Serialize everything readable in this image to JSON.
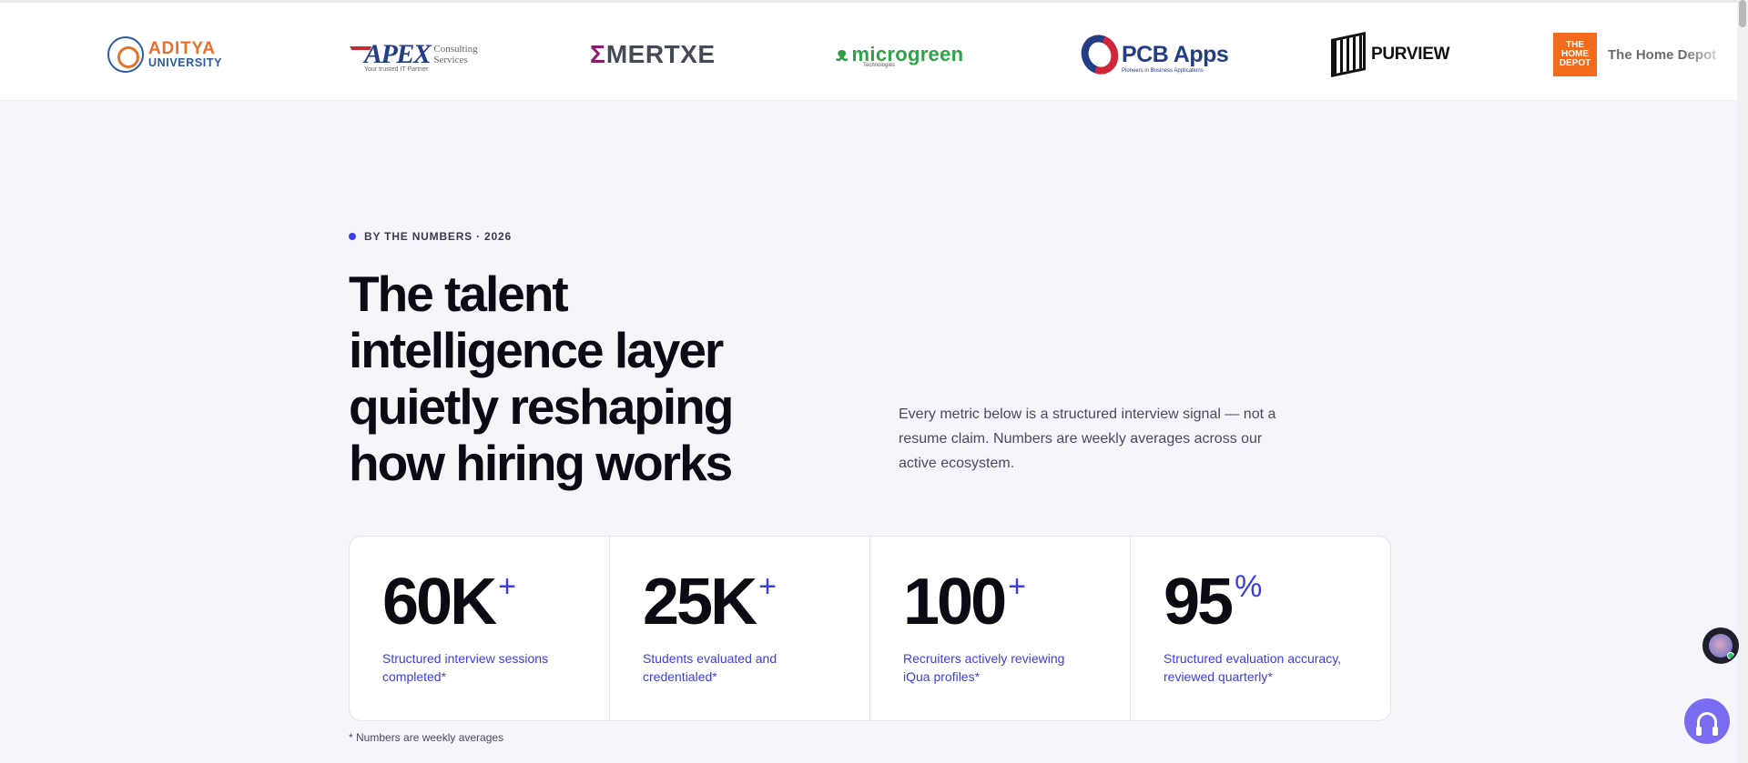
{
  "logos": {
    "aditya": {
      "line1": "ADITYA",
      "line2": "UNIVERSITY"
    },
    "apex": {
      "name": "APEX",
      "side1": "Consulting",
      "side2": "Services",
      "tagline": "Your trusted IT Partner"
    },
    "mertxe": {
      "mark": "Σ",
      "name": "MERTXE"
    },
    "microgreen": {
      "mark": "ᴥ",
      "name": "microgreen",
      "sub": "Technologies"
    },
    "pcb": {
      "name": "PCB Apps",
      "sub": "Pioneers in Business Applications"
    },
    "purview": {
      "name": "PURVIEW"
    },
    "homedepot": {
      "badge": "THE HOME DEPOT",
      "name": "The Home Depot"
    }
  },
  "section": {
    "eyebrow": "BY THE NUMBERS · 2026",
    "headline": [
      "The talent",
      "intelligence layer",
      "quietly reshaping",
      "how hiring works"
    ],
    "intro": "Every metric below is a structured interview signal — not a resume claim. Numbers are weekly averages across our active ecosystem.",
    "stats": [
      {
        "value": "60K",
        "suffix": "+",
        "label": "Structured interview sessions completed*"
      },
      {
        "value": "25K",
        "suffix": "+",
        "label": "Students evaluated and credentialed*"
      },
      {
        "value": "100",
        "suffix": "+",
        "label": "Recruiters actively reviewing iQua profiles*"
      },
      {
        "value": "95",
        "suffix": "%",
        "label": "Structured evaluation accuracy, reviewed quarterly*"
      }
    ],
    "footnote": "* Numbers are weekly averages"
  },
  "colors": {
    "accent": "#3d3ee0",
    "support": "#7a6cf0",
    "background": "#f5f6fb"
  },
  "icons": {
    "avatar": "assistant-avatar-icon",
    "support": "headset-icon"
  }
}
